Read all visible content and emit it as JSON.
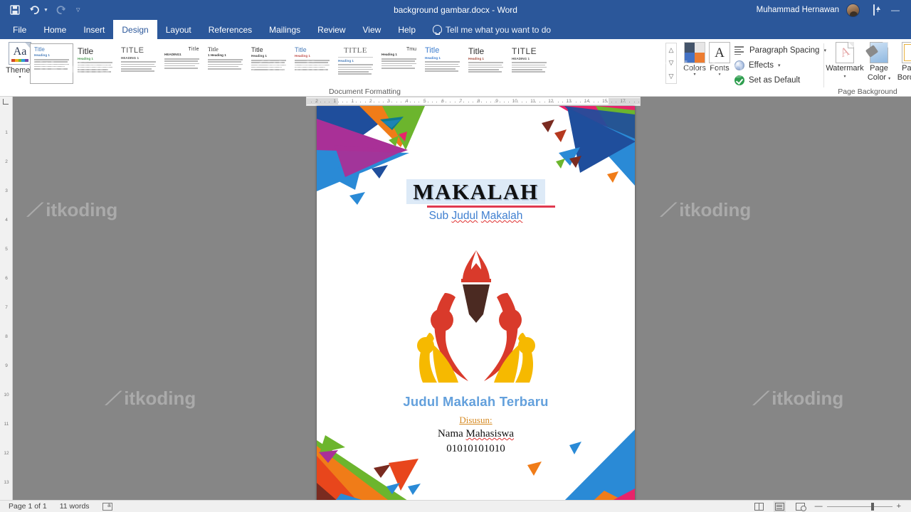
{
  "titlebar": {
    "document_title": "background gambar.docx  -  Word",
    "account_name": "Muhammad Hernawan",
    "qat": [
      {
        "name": "save",
        "glyph": "ὋE"
      },
      {
        "name": "undo",
        "glyph": "↶"
      },
      {
        "name": "redo",
        "glyph": "↷"
      },
      {
        "name": "customize",
        "glyph": "▽"
      }
    ],
    "ribbon_display_options": "Ribbon Display Options",
    "minimize": "—"
  },
  "tabs": [
    {
      "label": "File",
      "active": false
    },
    {
      "label": "Home",
      "active": false
    },
    {
      "label": "Insert",
      "active": false
    },
    {
      "label": "Design",
      "active": true
    },
    {
      "label": "Layout",
      "active": false
    },
    {
      "label": "References",
      "active": false
    },
    {
      "label": "Mailings",
      "active": false
    },
    {
      "label": "Review",
      "active": false
    },
    {
      "label": "View",
      "active": false
    },
    {
      "label": "Help",
      "active": false
    }
  ],
  "tellme": {
    "placeholder": "Tell me what you want to do"
  },
  "ribbon": {
    "themes": {
      "label": "Themes",
      "caret": "▾",
      "swatches": [
        "#d24726",
        "#f2b01e",
        "#7cb82f",
        "#2b9fd8",
        "#7048a8"
      ]
    },
    "document_formatting_label": "Document Formatting",
    "gallery": [
      {
        "title": "Title",
        "title_color": "#4a7ebb",
        "title_size": 8,
        "title_serif": false,
        "title_align": "left",
        "heading": "Heading 1",
        "heading_color": "#4a7ebb",
        "selected": true,
        "upper": false,
        "rule": false
      },
      {
        "title": "Title",
        "title_color": "#333333",
        "title_size": 12,
        "title_serif": false,
        "title_align": "left",
        "heading": "Heading 1",
        "heading_color": "#4a9a52",
        "selected": false,
        "upper": false,
        "rule": false
      },
      {
        "title": "TITLE",
        "title_color": "#555555",
        "title_size": 11,
        "title_serif": false,
        "title_align": "left",
        "heading": "HEADING 1",
        "heading_color": "#5a5a5a",
        "selected": false,
        "upper": true,
        "rule": false
      },
      {
        "title": "Title",
        "title_color": "#2f2f2f",
        "title_size": 7,
        "title_serif": false,
        "title_align": "right",
        "heading": "HEADING1",
        "heading_color": "#3a3a3a",
        "selected": false,
        "upper": true,
        "rule": false
      },
      {
        "title": "Title",
        "title_color": "#2f2f2f",
        "title_size": 8,
        "title_serif": true,
        "title_align": "left",
        "heading": "1  Heading 1",
        "heading_color": "#333333",
        "selected": false,
        "upper": false,
        "rule": false
      },
      {
        "title": "Title",
        "title_color": "#333333",
        "title_size": 9,
        "title_serif": false,
        "title_align": "left",
        "heading": "Heading 1",
        "heading_color": "#444444",
        "selected": false,
        "upper": false,
        "rule": false
      },
      {
        "title": "Title",
        "title_color": "#4a7ebb",
        "title_size": 9,
        "title_serif": false,
        "title_align": "left",
        "heading": "Heading 1",
        "heading_color": "#c0504d",
        "selected": false,
        "upper": false,
        "rule": false
      },
      {
        "title": "TITLE",
        "title_color": "#666666",
        "title_size": 11,
        "title_serif": true,
        "title_align": "center",
        "heading": "Heading 1",
        "heading_color": "#4a7ebb",
        "selected": false,
        "upper": true,
        "rule": true
      },
      {
        "title": "Tmu",
        "title_color": "#3a3a3a",
        "title_size": 7,
        "title_serif": false,
        "title_align": "right",
        "heading": "Heading  1",
        "heading_color": "#333333",
        "selected": false,
        "upper": false,
        "rule": false
      },
      {
        "title": "Title",
        "title_color": "#3f7fd0",
        "title_size": 11,
        "title_serif": false,
        "title_align": "left",
        "heading": "Heading 1",
        "heading_color": "#3f7fd0",
        "selected": false,
        "upper": false,
        "rule": false
      },
      {
        "title": "Title",
        "title_color": "#2f2f2f",
        "title_size": 12,
        "title_serif": false,
        "title_align": "left",
        "heading": "Heading 1",
        "heading_color": "#a34a3a",
        "selected": false,
        "upper": false,
        "rule": false
      },
      {
        "title": "TITLE",
        "title_color": "#3a3a3a",
        "title_size": 12,
        "title_serif": false,
        "title_align": "left",
        "heading": "HEADING 1",
        "heading_color": "#555555",
        "selected": false,
        "upper": true,
        "rule": false
      }
    ],
    "gallery_scroll": {
      "up": "△",
      "middle": "▽",
      "down": "▽"
    },
    "colors": {
      "label": "Colors",
      "caret": "▾",
      "swatch_colors": [
        "#44546a",
        "#e7e6e6",
        "#4472c4",
        "#ed7d31"
      ]
    },
    "fonts": {
      "label": "Fonts",
      "caret": "▾",
      "glyph": "A"
    },
    "paragraph_spacing": {
      "label": "Paragraph Spacing",
      "caret": "▾"
    },
    "effects": {
      "label": "Effects",
      "caret": "▾"
    },
    "set_as_default": {
      "label": "Set as Default"
    },
    "page_background": {
      "group_label": "Page Background",
      "watermark": {
        "label": "Watermark",
        "caret": "▾",
        "glyph": "A"
      },
      "page_color": {
        "label": "Page\nColor",
        "caret": "▾"
      },
      "page_borders": {
        "label": "Page\nBorders"
      }
    }
  },
  "ruler": {
    "horizontal_numbers": [
      "2",
      "1",
      "1",
      "2",
      "3",
      "4",
      "5",
      "6",
      "7",
      "8",
      "9",
      "10",
      "11",
      "12",
      "13",
      "14",
      "15",
      "17"
    ],
    "vertical_numbers": [
      "1",
      "2",
      "3",
      "4",
      "5",
      "6",
      "7",
      "8",
      "9",
      "10",
      "11",
      "12",
      "13"
    ]
  },
  "document": {
    "title": "MAKALAH",
    "subtitle_parts": [
      "Sub ",
      "Judul",
      " ",
      "Makalah"
    ],
    "subtitle": "Sub Judul Makalah",
    "main_heading": "Judul Makalah Terbaru",
    "disusun_label": "Disusun:",
    "student_name_first": "Nama ",
    "student_name_last": "Mahasiswa",
    "student_name": "Nama Mahasiswa",
    "student_id": "01010101010",
    "logo_name": "torch-with-people-logo",
    "colors": {
      "title_highlight": "#ddeaf7",
      "title_rule": "#e03a50",
      "subtitle": "#3f7fd0",
      "main_heading": "#63a0dc",
      "disusun": "#d68a22",
      "spelling_squiggle": "#e03030",
      "logo_red": "#d93a2b",
      "logo_dark": "#4b2a22",
      "logo_yellow": "#f6b900"
    },
    "decor_triangle_colors": [
      "#1f4e9c",
      "#f07c18",
      "#6cb52d",
      "#a93097",
      "#2a8ad6",
      "#e8246a",
      "#0f7a8c",
      "#7a2b20"
    ]
  },
  "statusbar": {
    "page_indicator": "Page 1 of 1",
    "word_count": "11 words",
    "proofing_icon": "proofing-errors-icon",
    "views": [
      {
        "name": "read-mode",
        "active": false
      },
      {
        "name": "print-layout",
        "active": true
      },
      {
        "name": "web-layout",
        "active": false
      }
    ],
    "zoom_minus": "—",
    "zoom_plus": "+"
  },
  "watermark_text": "itkoding"
}
